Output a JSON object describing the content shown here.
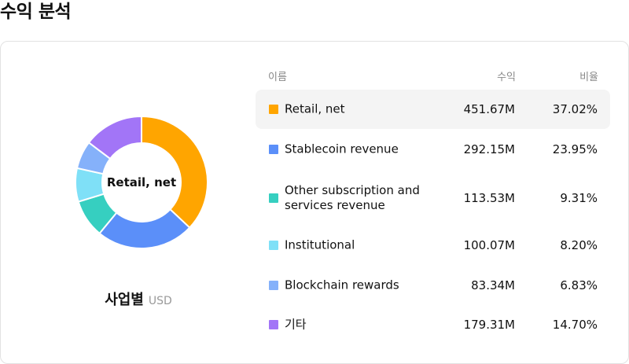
{
  "title": "수익 분석",
  "donut": {
    "center_label": "Retail, net",
    "subtitle": "사업별",
    "unit": "USD"
  },
  "table": {
    "headers": {
      "name": "이름",
      "revenue": "수익",
      "ratio": "비율"
    },
    "rows": [
      {
        "name": "Retail, net",
        "revenue": "451.67M",
        "ratio": "37.02%",
        "color": "#FFA500",
        "selected": true
      },
      {
        "name": "Stablecoin revenue",
        "revenue": "292.15M",
        "ratio": "23.95%",
        "color": "#5B8FF9",
        "selected": false
      },
      {
        "name": "Other subscription and services revenue",
        "revenue": "113.53M",
        "ratio": "9.31%",
        "color": "#36CFC0",
        "selected": false
      },
      {
        "name": "Institutional",
        "revenue": "100.07M",
        "ratio": "8.20%",
        "color": "#7FE0F7",
        "selected": false
      },
      {
        "name": "Blockchain rewards",
        "revenue": "83.34M",
        "ratio": "6.83%",
        "color": "#85B1FA",
        "selected": false
      },
      {
        "name": "기타",
        "revenue": "179.31M",
        "ratio": "14.70%",
        "color": "#A275F7",
        "selected": false
      }
    ]
  }
}
